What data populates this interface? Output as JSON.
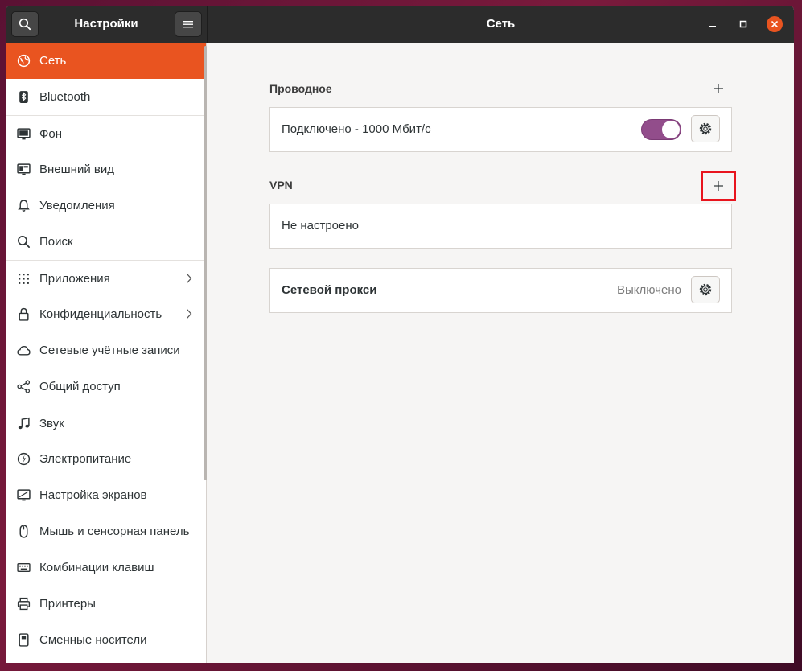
{
  "window": {
    "app_title": "Настройки",
    "page_title": "Сеть"
  },
  "sidebar": {
    "items": [
      {
        "label": "Сеть",
        "icon": "network-globe-icon",
        "active": true
      },
      {
        "label": "Bluetooth",
        "icon": "bluetooth-icon"
      },
      {
        "label": "Фон",
        "icon": "background-monitor-icon"
      },
      {
        "label": "Внешний вид",
        "icon": "appearance-icon"
      },
      {
        "label": "Уведомления",
        "icon": "bell-icon"
      },
      {
        "label": "Поиск",
        "icon": "search-icon"
      },
      {
        "label": "Приложения",
        "icon": "apps-grid-icon",
        "chevron": true
      },
      {
        "label": "Конфиденциальность",
        "icon": "lock-icon",
        "chevron": true
      },
      {
        "label": "Сетевые учётные записи",
        "icon": "cloud-icon"
      },
      {
        "label": "Общий доступ",
        "icon": "share-icon"
      },
      {
        "label": "Звук",
        "icon": "music-note-icon"
      },
      {
        "label": "Электропитание",
        "icon": "power-icon"
      },
      {
        "label": "Настройка экранов",
        "icon": "display-icon"
      },
      {
        "label": "Мышь и сенсорная панель",
        "icon": "mouse-icon"
      },
      {
        "label": "Комбинации клавиш",
        "icon": "keyboard-icon"
      },
      {
        "label": "Принтеры",
        "icon": "printer-icon"
      },
      {
        "label": "Сменные носители",
        "icon": "removable-media-icon"
      }
    ]
  },
  "main": {
    "wired": {
      "title": "Проводное",
      "connection_label": "Подключено - 1000 Мбит/с",
      "toggle_on": true
    },
    "vpn": {
      "title": "VPN",
      "empty_label": "Не настроено"
    },
    "proxy": {
      "label": "Сетевой прокси",
      "status": "Выключено"
    }
  },
  "colors": {
    "accent": "#e95420",
    "toggle": "#924d8b",
    "highlight": "#e8141d"
  }
}
